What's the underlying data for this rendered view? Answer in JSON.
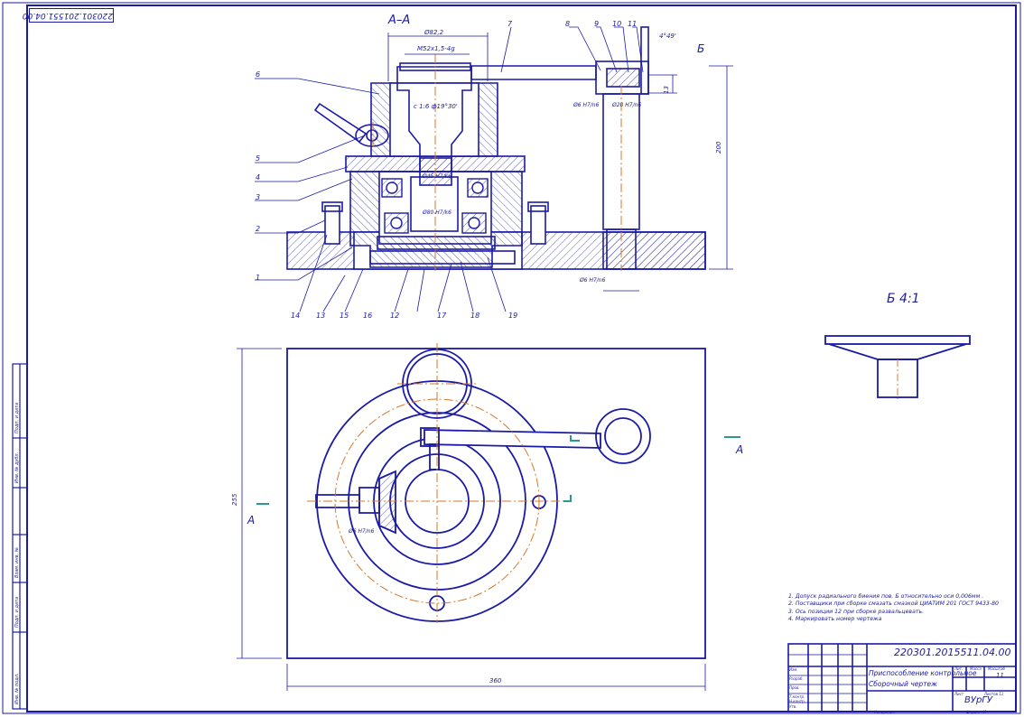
{
  "drawing": {
    "designation": "220301.2015511.04.00",
    "designation_stamp": "220301.201551.04.00",
    "title_line1": "Приспособление контрольное",
    "title_line2": "Сборочный чертеж",
    "org": "ВУрГУ",
    "sheets": "11",
    "section_label": "А–А",
    "view_label": "Б 4:1",
    "arrow_b": "Б",
    "arrow_a1": "А",
    "arrow_a2": "А"
  },
  "dimensions": {
    "d_top": "Ø82,2",
    "thread": "M52x1,5-4g",
    "cone": "с 1:6 ф19°30'",
    "bore_upper": "Ø45 H7/k6",
    "bore_lower": "Ø80 H7/k6",
    "pin1": "Ø6 H7/n6",
    "pin2": "Ø20 H7/n6",
    "pin3": "Ø6 H7/n6",
    "pin4": "Ø6 H7/n6",
    "angle": "4°49'",
    "height_right": "200",
    "height_small": "13",
    "width_bottom": "360",
    "height_left": "255"
  },
  "callouts": [
    "1",
    "2",
    "3",
    "4",
    "5",
    "6",
    "7",
    "8",
    "9",
    "10",
    "11",
    "12",
    "13",
    "14",
    "15",
    "16",
    "17",
    "18",
    "19"
  ],
  "notes": [
    "1. Допуск радиального биения пов. Б относительно оси 0,006мм .",
    "2. Поставщики при сборке смазать смазкой ЦИАТИМ 201 ГОСТ 9433-80",
    "3. Ось позиции 12 при сборке развальцевать.",
    "4. Маркировать номер чертежа"
  ],
  "title_block": {
    "rows": [
      "Изм.",
      "Разраб.",
      "Пров.",
      "Т.контр.",
      "Н.контр.",
      "Утв."
    ],
    "header": [
      "Лит.",
      "Масса",
      "Масштаб"
    ],
    "sheet_label": "Лист",
    "sheets_label": "Листов 11",
    "copied": "Копировал",
    "format": "Формат А1"
  },
  "left_stamps": [
    "Инв. № подл.",
    "Подп. и дата",
    "Взам. инв. №",
    "Инв. № дубл.",
    "Подп. и дата"
  ]
}
